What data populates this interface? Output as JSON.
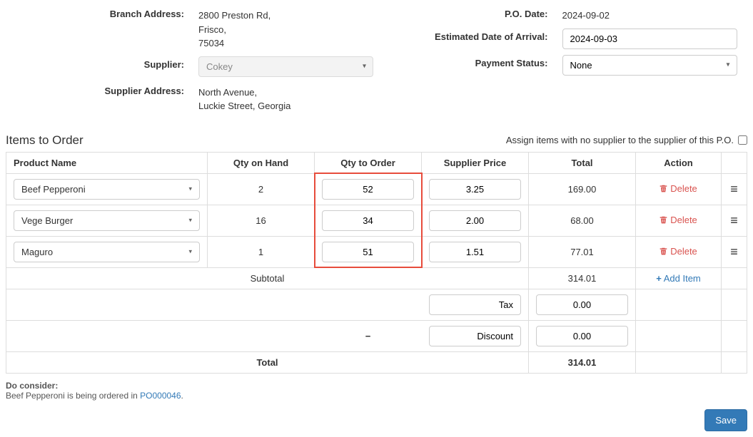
{
  "header": {
    "branch_address_label": "Branch Address:",
    "branch_address_value": "2800 Preston Rd,\nFrisco,\n75034",
    "supplier_label": "Supplier:",
    "supplier_value": "Cokey",
    "supplier_address_label": "Supplier Address:",
    "supplier_address_value": "North Avenue,\nLuckie Street, Georgia",
    "po_date_label": "P.O. Date:",
    "po_date_value": "2024-09-02",
    "eta_label": "Estimated Date of Arrival:",
    "eta_value": "2024-09-03",
    "payment_status_label": "Payment Status:",
    "payment_status_value": "None"
  },
  "section": {
    "title": "Items to Order",
    "assign_label": "Assign items with no supplier to the supplier of this P.O."
  },
  "columns": {
    "product": "Product Name",
    "qoh": "Qty on Hand",
    "qty": "Qty to Order",
    "price": "Supplier Price",
    "total": "Total",
    "action": "Action"
  },
  "rows": [
    {
      "product": "Beef Pepperoni",
      "qoh": "2",
      "qty": "52",
      "price": "3.25",
      "total": "169.00"
    },
    {
      "product": "Vege Burger",
      "qoh": "16",
      "qty": "34",
      "price": "2.00",
      "total": "68.00"
    },
    {
      "product": "Maguro",
      "qoh": "1",
      "qty": "51",
      "price": "1.51",
      "total": "77.01"
    }
  ],
  "actions": {
    "delete": "Delete",
    "add_item": "Add Item"
  },
  "summary": {
    "subtotal_label": "Subtotal",
    "subtotal_value": "314.01",
    "tax_label": "Tax",
    "tax_value": "0.00",
    "discount_label": "Discount",
    "discount_value": "0.00",
    "total_label": "Total",
    "total_value": "314.01"
  },
  "consider": {
    "title": "Do consider:",
    "text_prefix": "Beef Pepperoni is being ordered in ",
    "link_text": "PO000046",
    "text_suffix": "."
  },
  "footer": {
    "save": "Save"
  }
}
